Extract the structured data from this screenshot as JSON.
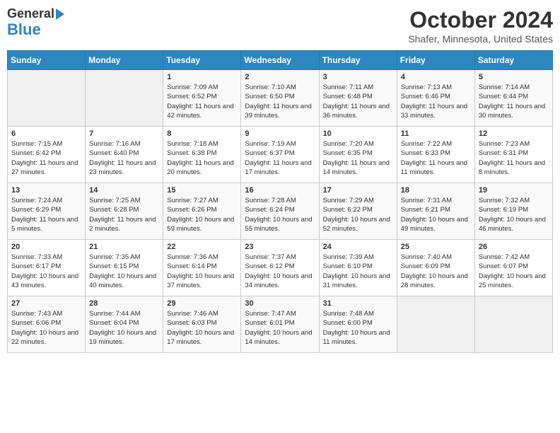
{
  "header": {
    "logo_line1": "General",
    "logo_line2": "Blue",
    "month": "October 2024",
    "location": "Shafer, Minnesota, United States"
  },
  "weekdays": [
    "Sunday",
    "Monday",
    "Tuesday",
    "Wednesday",
    "Thursday",
    "Friday",
    "Saturday"
  ],
  "weeks": [
    [
      {
        "day": "",
        "sunrise": "",
        "sunset": "",
        "daylight": ""
      },
      {
        "day": "",
        "sunrise": "",
        "sunset": "",
        "daylight": ""
      },
      {
        "day": "1",
        "sunrise": "Sunrise: 7:09 AM",
        "sunset": "Sunset: 6:52 PM",
        "daylight": "Daylight: 11 hours and 42 minutes."
      },
      {
        "day": "2",
        "sunrise": "Sunrise: 7:10 AM",
        "sunset": "Sunset: 6:50 PM",
        "daylight": "Daylight: 11 hours and 39 minutes."
      },
      {
        "day": "3",
        "sunrise": "Sunrise: 7:11 AM",
        "sunset": "Sunset: 6:48 PM",
        "daylight": "Daylight: 11 hours and 36 minutes."
      },
      {
        "day": "4",
        "sunrise": "Sunrise: 7:13 AM",
        "sunset": "Sunset: 6:46 PM",
        "daylight": "Daylight: 11 hours and 33 minutes."
      },
      {
        "day": "5",
        "sunrise": "Sunrise: 7:14 AM",
        "sunset": "Sunset: 6:44 PM",
        "daylight": "Daylight: 11 hours and 30 minutes."
      }
    ],
    [
      {
        "day": "6",
        "sunrise": "Sunrise: 7:15 AM",
        "sunset": "Sunset: 6:42 PM",
        "daylight": "Daylight: 11 hours and 27 minutes."
      },
      {
        "day": "7",
        "sunrise": "Sunrise: 7:16 AM",
        "sunset": "Sunset: 6:40 PM",
        "daylight": "Daylight: 11 hours and 23 minutes."
      },
      {
        "day": "8",
        "sunrise": "Sunrise: 7:18 AM",
        "sunset": "Sunset: 6:38 PM",
        "daylight": "Daylight: 11 hours and 20 minutes."
      },
      {
        "day": "9",
        "sunrise": "Sunrise: 7:19 AM",
        "sunset": "Sunset: 6:37 PM",
        "daylight": "Daylight: 11 hours and 17 minutes."
      },
      {
        "day": "10",
        "sunrise": "Sunrise: 7:20 AM",
        "sunset": "Sunset: 6:35 PM",
        "daylight": "Daylight: 11 hours and 14 minutes."
      },
      {
        "day": "11",
        "sunrise": "Sunrise: 7:22 AM",
        "sunset": "Sunset: 6:33 PM",
        "daylight": "Daylight: 11 hours and 11 minutes."
      },
      {
        "day": "12",
        "sunrise": "Sunrise: 7:23 AM",
        "sunset": "Sunset: 6:31 PM",
        "daylight": "Daylight: 11 hours and 8 minutes."
      }
    ],
    [
      {
        "day": "13",
        "sunrise": "Sunrise: 7:24 AM",
        "sunset": "Sunset: 6:29 PM",
        "daylight": "Daylight: 11 hours and 5 minutes."
      },
      {
        "day": "14",
        "sunrise": "Sunrise: 7:25 AM",
        "sunset": "Sunset: 6:28 PM",
        "daylight": "Daylight: 11 hours and 2 minutes."
      },
      {
        "day": "15",
        "sunrise": "Sunrise: 7:27 AM",
        "sunset": "Sunset: 6:26 PM",
        "daylight": "Daylight: 10 hours and 59 minutes."
      },
      {
        "day": "16",
        "sunrise": "Sunrise: 7:28 AM",
        "sunset": "Sunset: 6:24 PM",
        "daylight": "Daylight: 10 hours and 55 minutes."
      },
      {
        "day": "17",
        "sunrise": "Sunrise: 7:29 AM",
        "sunset": "Sunset: 6:22 PM",
        "daylight": "Daylight: 10 hours and 52 minutes."
      },
      {
        "day": "18",
        "sunrise": "Sunrise: 7:31 AM",
        "sunset": "Sunset: 6:21 PM",
        "daylight": "Daylight: 10 hours and 49 minutes."
      },
      {
        "day": "19",
        "sunrise": "Sunrise: 7:32 AM",
        "sunset": "Sunset: 6:19 PM",
        "daylight": "Daylight: 10 hours and 46 minutes."
      }
    ],
    [
      {
        "day": "20",
        "sunrise": "Sunrise: 7:33 AM",
        "sunset": "Sunset: 6:17 PM",
        "daylight": "Daylight: 10 hours and 43 minutes."
      },
      {
        "day": "21",
        "sunrise": "Sunrise: 7:35 AM",
        "sunset": "Sunset: 6:15 PM",
        "daylight": "Daylight: 10 hours and 40 minutes."
      },
      {
        "day": "22",
        "sunrise": "Sunrise: 7:36 AM",
        "sunset": "Sunset: 6:14 PM",
        "daylight": "Daylight: 10 hours and 37 minutes."
      },
      {
        "day": "23",
        "sunrise": "Sunrise: 7:37 AM",
        "sunset": "Sunset: 6:12 PM",
        "daylight": "Daylight: 10 hours and 34 minutes."
      },
      {
        "day": "24",
        "sunrise": "Sunrise: 7:39 AM",
        "sunset": "Sunset: 6:10 PM",
        "daylight": "Daylight: 10 hours and 31 minutes."
      },
      {
        "day": "25",
        "sunrise": "Sunrise: 7:40 AM",
        "sunset": "Sunset: 6:09 PM",
        "daylight": "Daylight: 10 hours and 28 minutes."
      },
      {
        "day": "26",
        "sunrise": "Sunrise: 7:42 AM",
        "sunset": "Sunset: 6:07 PM",
        "daylight": "Daylight: 10 hours and 25 minutes."
      }
    ],
    [
      {
        "day": "27",
        "sunrise": "Sunrise: 7:43 AM",
        "sunset": "Sunset: 6:06 PM",
        "daylight": "Daylight: 10 hours and 22 minutes."
      },
      {
        "day": "28",
        "sunrise": "Sunrise: 7:44 AM",
        "sunset": "Sunset: 6:04 PM",
        "daylight": "Daylight: 10 hours and 19 minutes."
      },
      {
        "day": "29",
        "sunrise": "Sunrise: 7:46 AM",
        "sunset": "Sunset: 6:03 PM",
        "daylight": "Daylight: 10 hours and 17 minutes."
      },
      {
        "day": "30",
        "sunrise": "Sunrise: 7:47 AM",
        "sunset": "Sunset: 6:01 PM",
        "daylight": "Daylight: 10 hours and 14 minutes."
      },
      {
        "day": "31",
        "sunrise": "Sunrise: 7:48 AM",
        "sunset": "Sunset: 6:00 PM",
        "daylight": "Daylight: 10 hours and 11 minutes."
      },
      {
        "day": "",
        "sunrise": "",
        "sunset": "",
        "daylight": ""
      },
      {
        "day": "",
        "sunrise": "",
        "sunset": "",
        "daylight": ""
      }
    ]
  ]
}
